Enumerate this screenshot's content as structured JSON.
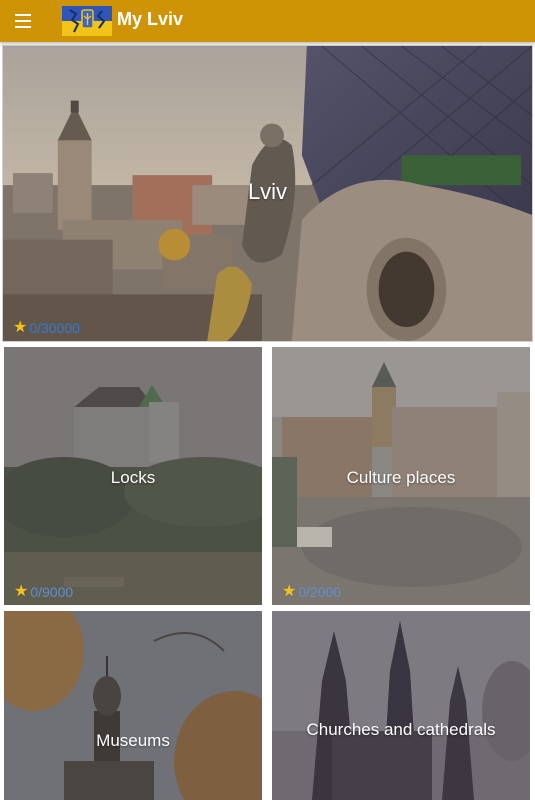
{
  "app": {
    "title": "My Lviv"
  },
  "hero": {
    "title": "Lviv",
    "score": "0/30000"
  },
  "categories": [
    {
      "title": "Locks",
      "score": "0/9000"
    },
    {
      "title": "Culture places",
      "score": "0/2000"
    },
    {
      "title": "Museums",
      "score": ""
    },
    {
      "title": "Churches and cathedrals",
      "score": ""
    }
  ],
  "colors": {
    "appbar": "#cf9306",
    "star": "#f4c11c",
    "score_hero": "#2f7bd6",
    "score_card": "#5e8fd0"
  },
  "icons": {
    "menu": "hamburger-menu-icon",
    "logo": "lviv-coat-of-arms-logo",
    "star": "star-icon"
  }
}
